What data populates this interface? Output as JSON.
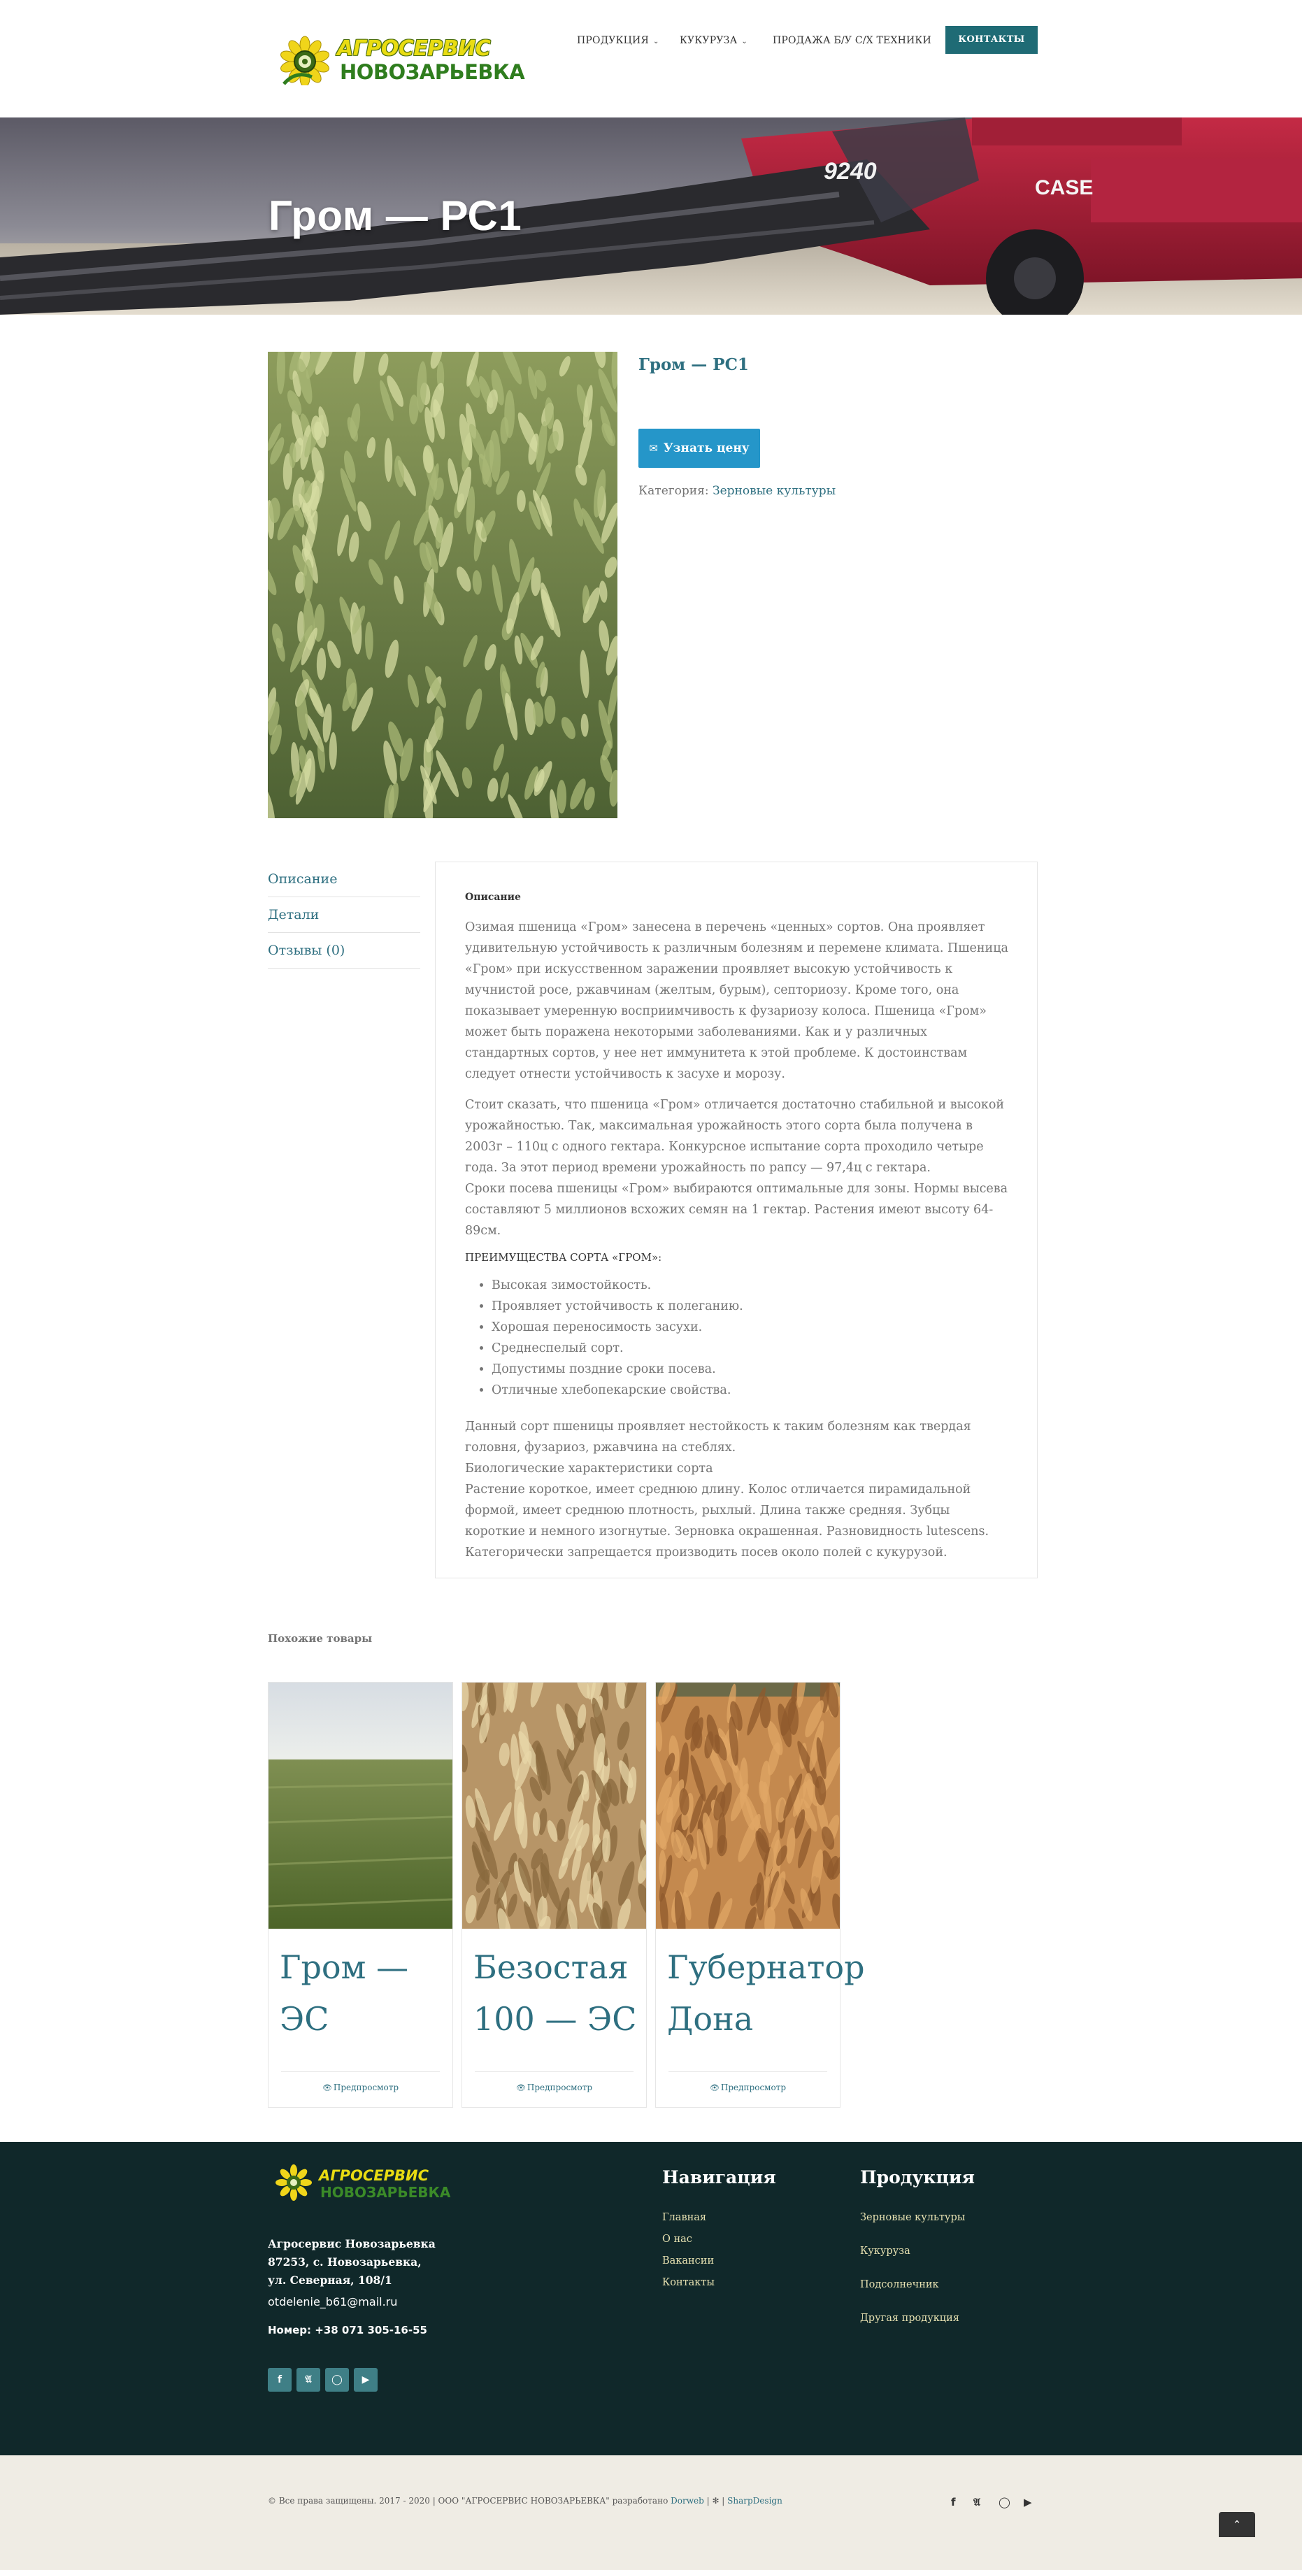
{
  "header": {
    "logo_line1": "АГРОСЕРВИС",
    "logo_line2": "НОВОЗАРЬЕВКА",
    "nav": [
      {
        "label": "ПРОДУКЦИЯ",
        "has_dropdown": true
      },
      {
        "label": "КУКУРУЗА",
        "has_dropdown": true
      },
      {
        "label": "ПРОДАЖА Б/У С/Х ТЕХНИКИ",
        "has_dropdown": false
      }
    ],
    "contact_label": "КОНТАКТЫ",
    "chevron_icon": "chevron-down-icon"
  },
  "hero": {
    "title": "Гром — РС1",
    "machine_text_1": "9240",
    "machine_text_2": "CASE"
  },
  "product": {
    "title": "Гром — РС1",
    "price_button": "Узнать цену",
    "price_icon": "envelope-icon",
    "category_label": "Категория:",
    "category_value": "Зерновые культуры"
  },
  "tabs": [
    {
      "label": "Описание"
    },
    {
      "label": "Детали"
    },
    {
      "label": "Отзывы (0)"
    }
  ],
  "description": {
    "heading": "Описание",
    "p1": "Озимая пшеница «Гром» занесена в перечень «ценных» сортов. Она проявляет удивительную устойчивость к различным болезням и перемене климата. Пшеница «Гром» при искусственном заражении проявляет высокую устойчивость к мучнистой росе, ржавчинам (желтым, бурым), септориозу. Кроме того, она показывает умеренную восприимчивость к фузариозу колоса. Пшеница «Гром» может быть поражена некоторыми заболеваниями. Как и у различных стандартных сортов, у нее нет иммунитета к этой проблеме. К достоинствам следует отнести устойчивость к засухе и морозу.",
    "p2a": "Стоит сказать, что пшеница «Гром» отличается достаточно стабильной и высокой урожайностью. Так, максимальная урожайность этого сорта была получена в 2003г – 110ц с одного гектара. Конкурсное испытание сорта проходило четыре года. За этот период времени урожайность по рапсу — 97,4ц с гектара.",
    "p2b": "Сроки посева пшеницы «Гром» выбираются оптимальные для зоны. Нормы высева составляют 5 миллионов всхожих семян на 1 гектар. Растения имеют высоту 64-89см.",
    "advantages_heading": "ПРЕИМУЩЕСТВА СОРТА «ГРОМ»:",
    "advantages": [
      "Высокая зимостойкость.",
      "Проявляет устойчивость к полеганию.",
      "Хорошая переносимость засухи.",
      "Среднеспелый сорт.",
      "Допустимы поздние сроки посева.",
      "Отличные хлебопекарские свойства."
    ],
    "p3a": "Данный сорт пшеницы проявляет нестойкость к таким болезням как твердая головня, фузариоз, ржавчина на стеблях.",
    "p3b": "Биологические характеристики сорта",
    "p3c": "Растение короткое, имеет среднюю длину. Колос отличается пирамидальной формой, имеет среднюю плотность, рыхлый. Длина также средняя. Зубцы короткие и немного изогнутые. Зерновка окрашенная. Разновидность lutescens. Категорически запрещается производить посев около полей с кукурузой."
  },
  "related": {
    "heading": "Похожие товары",
    "preview_label": "Предпросмотр",
    "preview_icon": "eye-icon",
    "items": [
      {
        "title": "Гром — ЭС"
      },
      {
        "title": "Безостая 100 — ЭС"
      },
      {
        "title": "Губернатор Дона"
      }
    ]
  },
  "footer": {
    "logo_line1": "АГРОСЕРВИС",
    "logo_line2": "НОВОЗАРЬЕВКА",
    "address": "Агросервис Новозарьевка 87253, с. Новозарьевка, ул. Северная, 108/1",
    "email": "otdelenie_b61@mail.ru",
    "phone_label": "Номер:",
    "phone": "+38 071 305-16-55",
    "social": [
      "f",
      "t",
      "ig",
      "yt"
    ],
    "nav_title": "Навигация",
    "nav_links": [
      "Главная",
      "О нас",
      "Вакансии",
      "Контакты"
    ],
    "products_title": "Продукция",
    "product_links": [
      "Зерновые культуры",
      "Кукуруза",
      "Подсолнечник",
      "Другая продукция"
    ]
  },
  "copyright": {
    "text": "© Все права защищены. 2017 - 2020 | ООО \"АГРОСЕРВИС НОВОЗАРЬЕВКА\" разработано",
    "dev": "Dorweb",
    "sep": " | ✻ | ",
    "design": "SharpDesign",
    "social": [
      "f",
      "t",
      "ig",
      "yt"
    ],
    "to_top_icon": "chevron-up-icon"
  },
  "colors": {
    "accent": "#2e6f80",
    "button_blue": "#2596c9",
    "contact_teal": "#1f6b75",
    "footer_bg": "#10282a",
    "copy_bg": "#efece4"
  }
}
